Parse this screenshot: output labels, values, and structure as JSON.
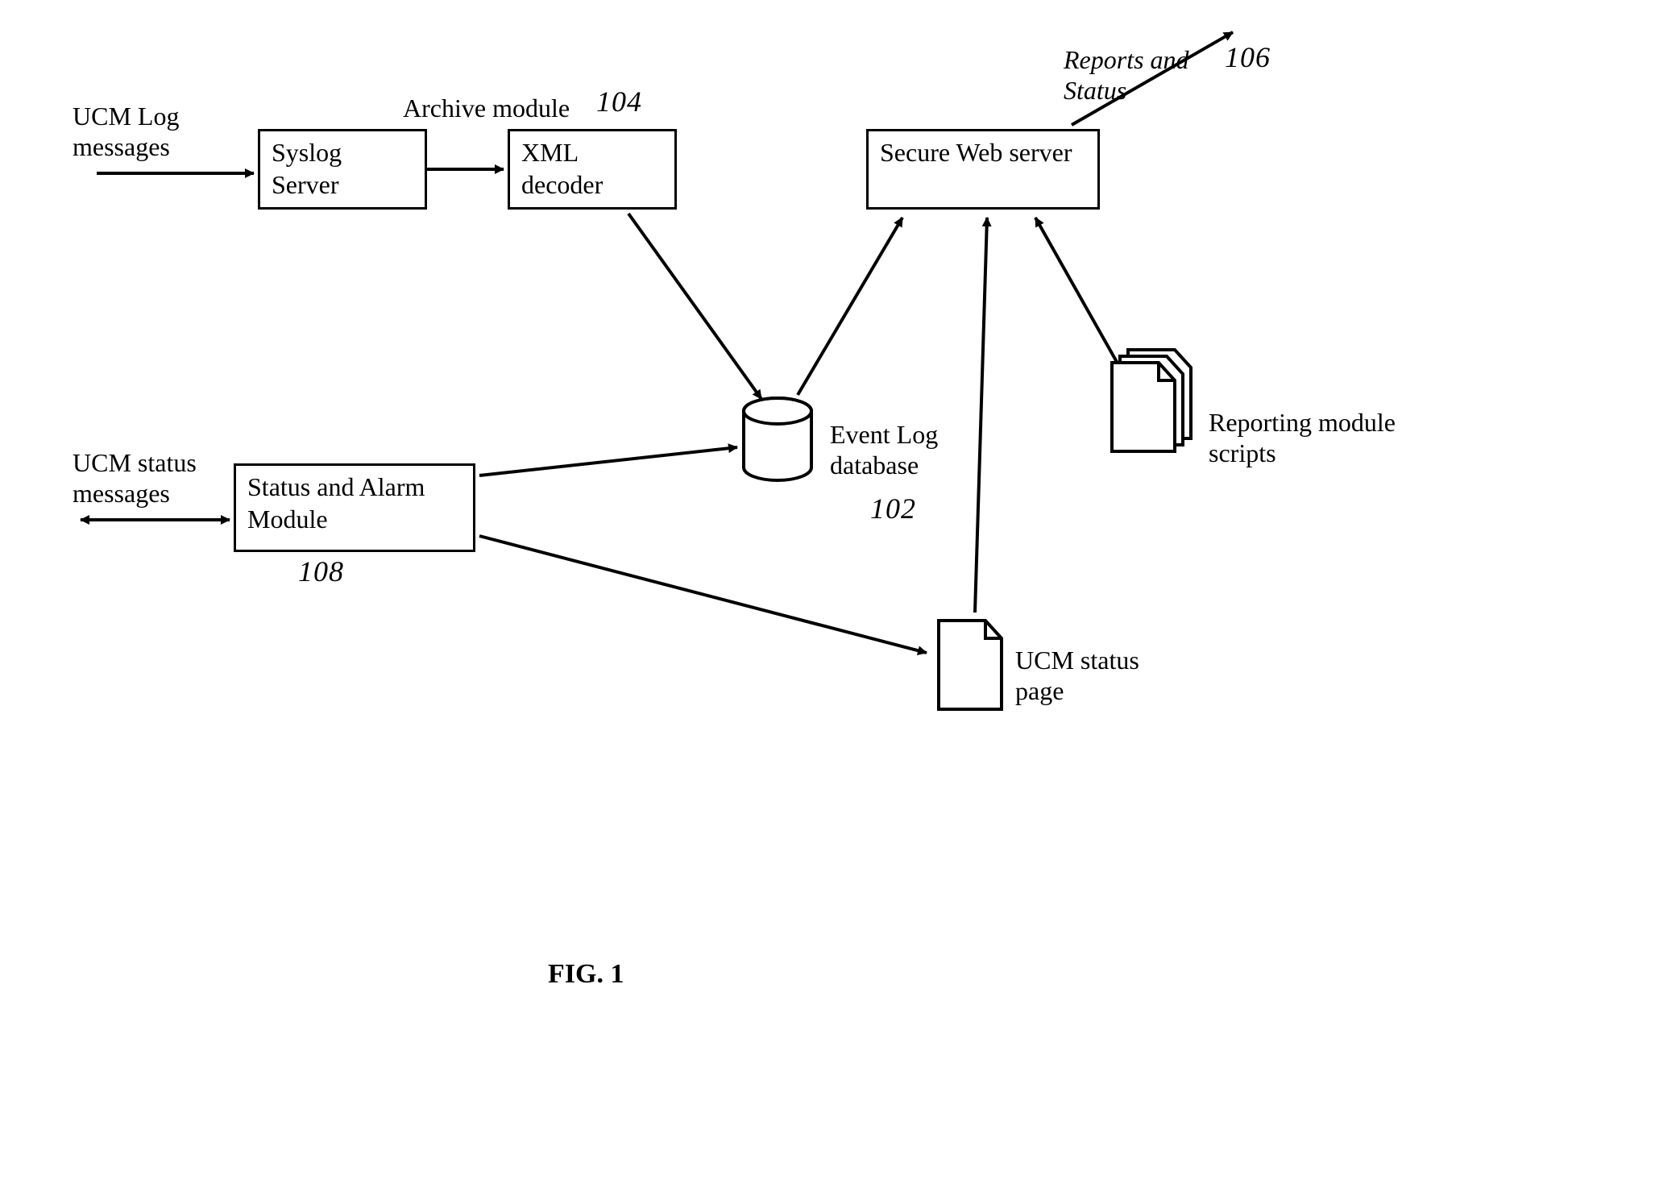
{
  "inputs": {
    "ucm_log": "UCM Log\nmessages",
    "ucm_status": "UCM status\nmessages"
  },
  "boxes": {
    "syslog": "Syslog\nServer",
    "xml_decoder": "XML\ndecoder",
    "secure_web": "Secure Web\nserver",
    "status_alarm": "Status and Alarm\nModule"
  },
  "labels": {
    "archive_module": "Archive module",
    "reports_status": "Reports and\nStatus",
    "event_log_db": "Event Log\ndatabase",
    "reporting_scripts": "Reporting module\nscripts",
    "ucm_status_page": "UCM status\npage"
  },
  "refs": {
    "ref_104": "104",
    "ref_106": "106",
    "ref_102": "102",
    "ref_108": "108"
  },
  "figure_caption": "FIG. 1"
}
